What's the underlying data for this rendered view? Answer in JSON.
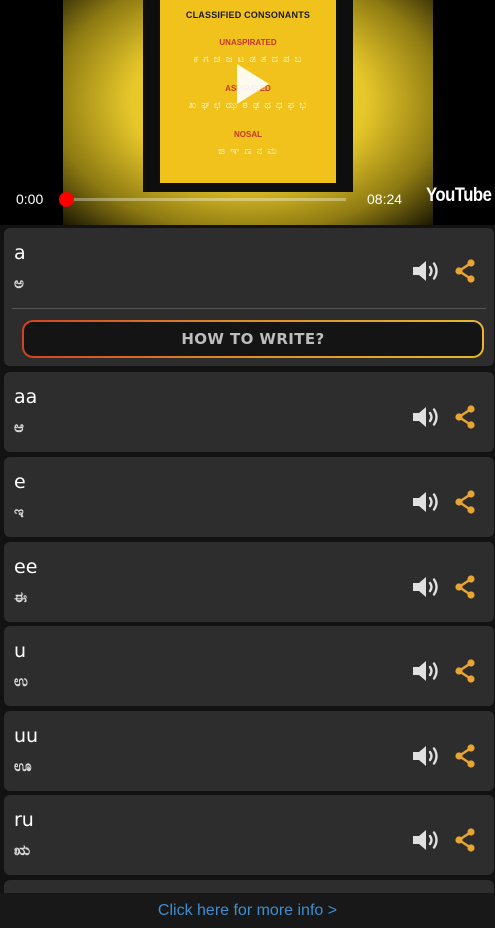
{
  "video": {
    "poster_title": "CLASSIFIED CONSONANTS",
    "poster_heading_1": "UNASPIRATED",
    "poster_row_1": "ಕ ಗ ಚ ಜ ಟ ಡ ತ ದ ಪ ಬ",
    "poster_heading_2": "ASPIRATED",
    "poster_row_2": "ಖ ಘ ಛ ಝ ಠ ಢ ಥ ಧ ಫ ಭ",
    "poster_heading_3": "NOSAL",
    "poster_row_3": "ಙ ಞ ಣ ನ ಮ",
    "current_time": "0:00",
    "duration": "08:24",
    "progress": 0,
    "logo": "YouTube",
    "icon": "play-icon"
  },
  "letters": [
    {
      "roman": "a",
      "native": "ಅ"
    },
    {
      "roman": "aa",
      "native": "ಆ"
    },
    {
      "roman": "e",
      "native": "ಇ"
    },
    {
      "roman": "ee",
      "native": "ಈ"
    },
    {
      "roman": "u",
      "native": "ಉ"
    },
    {
      "roman": "uu",
      "native": "ಊ"
    },
    {
      "roman": "ru",
      "native": "ಋ"
    }
  ],
  "how_to_write_label": "HOW TO WRITE?",
  "footer": {
    "link_text": "Click here for more info >"
  },
  "icons": {
    "audio": "speaker-icon",
    "share": "share-icon"
  },
  "colors": {
    "accent": "#e8a531",
    "card": "#2d2d2d",
    "background": "#121212",
    "link": "#3d8dd1",
    "progress": "#ff0000"
  }
}
